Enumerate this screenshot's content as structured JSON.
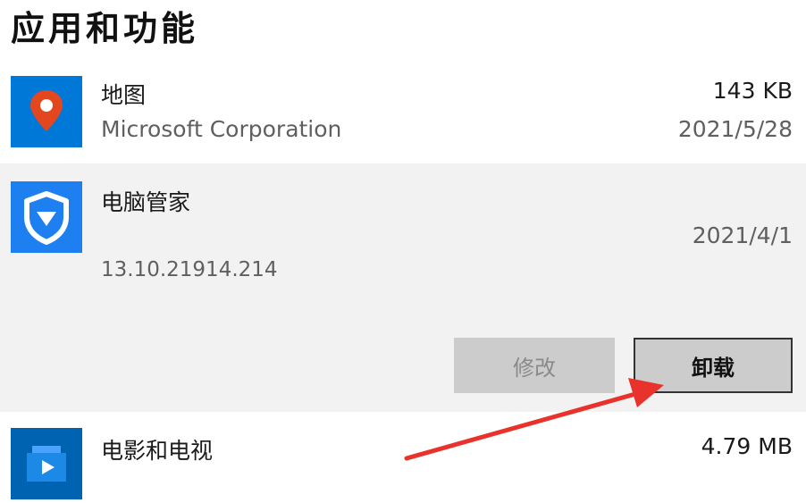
{
  "page": {
    "heading": "应用和功能"
  },
  "apps": [
    {
      "name": "地图",
      "publisher": "Microsoft Corporation",
      "size": "143 KB",
      "date": "2021/5/28",
      "icon": "map-pin-icon",
      "icon_color": "#0078d7"
    },
    {
      "name": "电脑管家",
      "version": "13.10.21914.214",
      "date": "2021/4/1",
      "icon": "shield-check-icon",
      "icon_color": "#1e7ff0",
      "selected": true,
      "buttons": {
        "modify": "修改",
        "uninstall": "卸载"
      }
    },
    {
      "name": "电影和电视",
      "size": "4.79 MB",
      "icon": "film-play-icon",
      "icon_color": "#0063b1"
    }
  ],
  "annotation": {
    "arrow_color": "#e8322b"
  }
}
